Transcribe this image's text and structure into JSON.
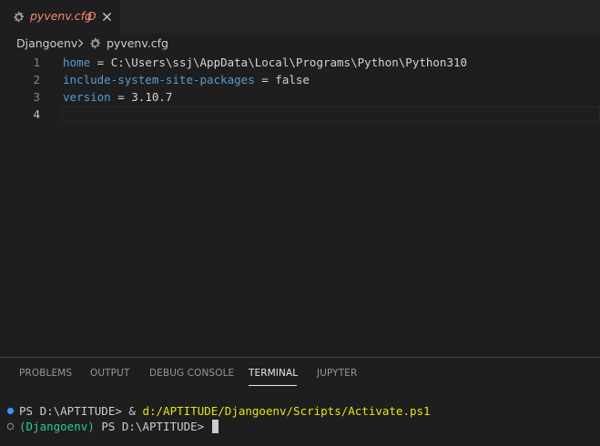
{
  "tab": {
    "filename": "pyvenv.cfg",
    "status_flag": "D"
  },
  "breadcrumb": {
    "folder": "Djangoenv",
    "file": "pyvenv.cfg"
  },
  "editor": {
    "lines": [
      {
        "number": "1",
        "key": "home",
        "op": " = ",
        "value": "C:\\Users\\ssj\\AppData\\Local\\Programs\\Python\\Python310"
      },
      {
        "number": "2",
        "key": "include-system-site-packages",
        "op": " = ",
        "value": "false"
      },
      {
        "number": "3",
        "key": "version",
        "op": " = ",
        "value": "3.10.7"
      },
      {
        "number": "4",
        "key": "",
        "op": "",
        "value": ""
      }
    ],
    "active_line": "4"
  },
  "panel": {
    "tabs": [
      "PROBLEMS",
      "OUTPUT",
      "DEBUG CONSOLE",
      "TERMINAL",
      "JUPYTER"
    ],
    "active_tab": "TERMINAL"
  },
  "terminal": {
    "line1": {
      "prompt": "PS D:\\APTITUDE> ",
      "amp": "& ",
      "command": "d:/APTITUDE/Djangoenv/Scripts/Activate.ps1"
    },
    "line2": {
      "venv": "(Djangoenv)",
      "prompt": " PS D:\\APTITUDE> "
    }
  },
  "colors": {
    "tab_modified": "#f48771",
    "keyword": "#569cd6",
    "terminal_command": "#e5e510",
    "terminal_venv": "#23d18b",
    "dot_success": "#3794ff"
  }
}
